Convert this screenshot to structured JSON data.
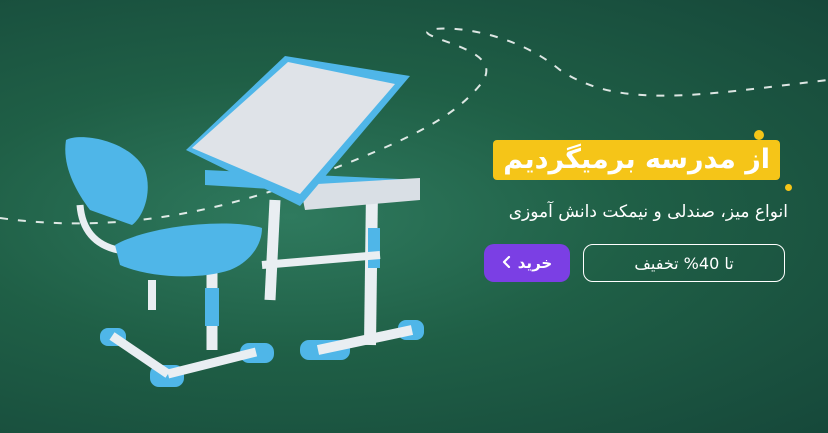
{
  "banner": {
    "headline": "از مدرسه برمیگردیم",
    "subtitle": "انواع میز، صندلی و نیمکت دانش آموزی",
    "discount_label": "تا 40% تخفیف",
    "buy_label": "خرید",
    "buy_icon": "chevron-left-icon",
    "product_image": "kids-desk-and-chair-image"
  },
  "colors": {
    "background": "#1f5f46",
    "headline_highlight": "#f5c518",
    "buy_button": "#7b3fe4",
    "desk_blue": "#4fb6e8"
  }
}
